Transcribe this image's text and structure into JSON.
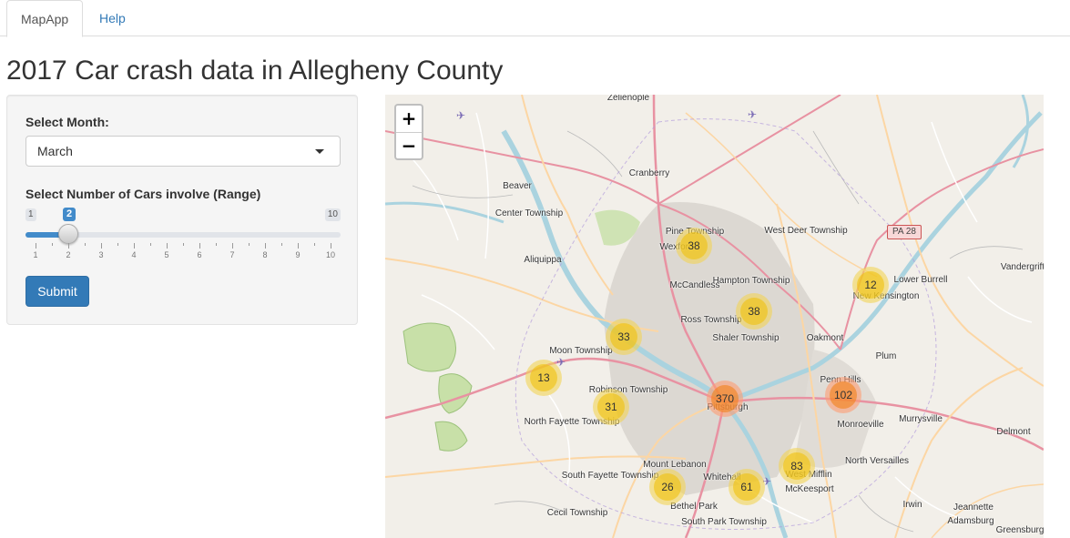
{
  "tabs": [
    {
      "label": "MapApp",
      "active": true
    },
    {
      "label": "Help",
      "active": false
    }
  ],
  "page_title": "2017 Car crash data in Allegheny County",
  "controls": {
    "month_label": "Select Month:",
    "month_value": "March",
    "cars_label": "Select Number of Cars involve (Range)",
    "slider": {
      "min": 1,
      "max": 10,
      "value": 2,
      "min_text": "1",
      "max_text": "10",
      "value_text": "2",
      "ticks": [
        "1",
        "2",
        "3",
        "4",
        "5",
        "6",
        "7",
        "8",
        "9",
        "10"
      ]
    },
    "submit_label": "Submit"
  },
  "map": {
    "zoom_in": "+",
    "zoom_out": "−",
    "route_shield": "PA 28",
    "places": [
      "Zelienople",
      "Cranberry",
      "Beaver",
      "Center Township",
      "Aliquippa",
      "Pine Township",
      "Wexford",
      "West Deer Township",
      "Lower Burrell",
      "New Kensington",
      "Vandergrift",
      "McCandless",
      "Hampton Township",
      "Ross Township",
      "Shaler Township",
      "Oakmont",
      "Moon Township",
      "Robinson Township",
      "Plum",
      "Penn Hills",
      "Pittsburgh",
      "North Fayette Township",
      "Monroeville",
      "Murrysville",
      "Delmont",
      "Mount Lebanon",
      "North Versailles",
      "West Mifflin",
      "South Fayette Township",
      "Whitehall",
      "McKeesport",
      "Bethel Park",
      "Irwin",
      "Jeannette",
      "Cecil Township",
      "South Park Township",
      "Adamsburg",
      "Greensburg"
    ],
    "clusters": [
      {
        "count": "38",
        "size": "med"
      },
      {
        "count": "12",
        "size": "med"
      },
      {
        "count": "38",
        "size": "med"
      },
      {
        "count": "33",
        "size": "med"
      },
      {
        "count": "13",
        "size": "med"
      },
      {
        "count": "370",
        "size": "large"
      },
      {
        "count": "102",
        "size": "large"
      },
      {
        "count": "31",
        "size": "med"
      },
      {
        "count": "83",
        "size": "med"
      },
      {
        "count": "26",
        "size": "med"
      },
      {
        "count": "61",
        "size": "med"
      }
    ],
    "colors": {
      "land": "#f2efe9",
      "river": "#aad3df",
      "motorway": "#e892a2",
      "primary": "#fcd6a4",
      "urban": "#d9d4cf",
      "park": "#c8e0a8"
    }
  }
}
